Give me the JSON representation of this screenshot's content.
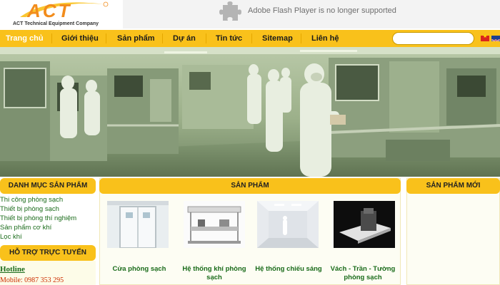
{
  "header": {
    "logo_text": "ACT",
    "logo_subtitle": "ACT Technical Equipment Company",
    "flash_message": "Adobe Flash Player is no longer supported"
  },
  "nav": {
    "items": [
      "Trang chủ",
      "Giới thiệu",
      "Sản phẩm",
      "Dự án",
      "Tin tức",
      "Sitemap",
      "Liên hệ"
    ],
    "active": "Trang chủ",
    "search_value": ""
  },
  "colors": {
    "accent": "#f9c11b",
    "link_green": "#1a6b1a",
    "logo_orange": "#f28c1c",
    "mobile_red": "#cc2d00"
  },
  "sidebar": {
    "categories_title": "DANH MỤC SẢN PHẨM",
    "categories": [
      "Thi công phòng sạch",
      "Thiết bị phòng sạch",
      "Thiết bị phòng thí nghiệm",
      "Sản phẩm cơ khí",
      "Lọc khí"
    ],
    "support_title": "HỖ TRỢ TRỰC TUYẾN",
    "hotline_label": "Hotline",
    "mobile_label": "Mobile:  0987 353 295"
  },
  "products": {
    "title": "SẢN PHẨM",
    "items": [
      {
        "name": "Cửa phòng sạch",
        "icon": "cleanroom-door-image"
      },
      {
        "name": "Hệ thống khí phòng sạch",
        "icon": "air-system-image"
      },
      {
        "name": "Hệ thống chiếu sáng",
        "icon": "lighting-system-image"
      },
      {
        "name": "Vách - Trần - Tường phòng sạch",
        "icon": "wall-panel-image"
      }
    ]
  },
  "new_products": {
    "title": "SẢN PHẨM MỚI"
  },
  "banner": {
    "icon": "cleanroom-photo"
  }
}
